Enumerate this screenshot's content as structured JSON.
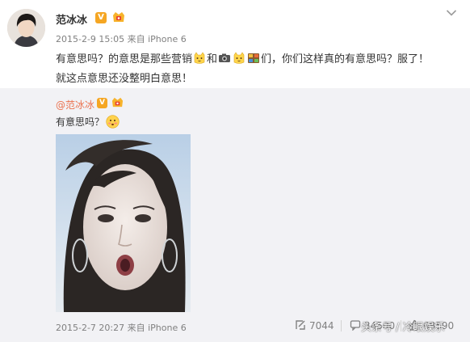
{
  "post": {
    "username": "范冰冰",
    "v_badge": "V",
    "meta": "2015-2-9 15:05 来自 iPhone 6",
    "text_segments": {
      "s1": "有意思吗？的意思是那些营销",
      "s2": "和",
      "s3": "们，你们这样真的有意思吗？服了！",
      "line2": "就这点意思还没整明白意思！"
    }
  },
  "repost": {
    "username": "@范冰冰",
    "v_badge": "V",
    "text": "有意思吗？",
    "meta": "2015-2-7 20:27 来自 iPhone 6",
    "actions": {
      "repost_count": "7044",
      "comment_count": "34500",
      "like_count": "68590"
    }
  },
  "watermark": "头条号 / 冷眼娱乐",
  "colors": {
    "accent_orange": "#eb7350",
    "verified_gold": "#f5a623",
    "repost_bg": "#f2f2f5",
    "meta_gray": "#808080"
  },
  "icons": [
    "chevron-down-icon",
    "verified-badge-icon",
    "vip-badge-icon",
    "cat-emoji-icon",
    "camera-emoji-icon",
    "movie-emoji-icon",
    "embarrassed-emoji-icon",
    "repost-icon",
    "comment-icon",
    "like-icon"
  ]
}
